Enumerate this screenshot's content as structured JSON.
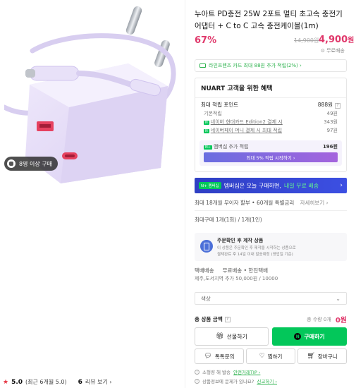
{
  "product": {
    "title": "누아트 PD충전 25W 2포트 멀티 초고속 충전기 어댑터 + C to C 고속 충전케이블(1m)",
    "discount": "67%",
    "original_price": "14,900원",
    "price": "4,900",
    "price_unit": "원",
    "shipping": "⊙ 무료배송",
    "buyers_badge": "8명 이상 구매",
    "rating": "5.0",
    "rating_note": "(최근 6개월 5.0)",
    "review_count": "6",
    "review_label": "리뷰 보기 ›"
  },
  "card_banner": {
    "text": "라인프렌즈 카드 최대 88원 추가 적립(2%) ›"
  },
  "benefit": {
    "header": "NUART 고객을 위한 혜택",
    "max_label": "최대 적립 포인트",
    "max_value": "888원",
    "rows": [
      {
        "label": "기본적립",
        "value": "49원"
      },
      {
        "label": "네이버 현대카드 Edition2 결제 시",
        "value": "343원"
      },
      {
        "label": "네이버페이 머니 결제 시 최대 적립",
        "value": "97원"
      }
    ],
    "member_label": "멤버십 추가 적립",
    "member_value": "196원",
    "member_bar": "최대 5% 적립 시작하기 ›",
    "badge": "N+"
  },
  "membership_banner": {
    "badge": "N+ 멤버십",
    "text": "멤버십은 오늘 구매하면,",
    "highlight": "내일 무료 배송"
  },
  "installment": {
    "text": "최대 18개월 무이자 할부 • 60개월 특별금리",
    "more": "자세히보기 ›"
  },
  "max_purchase": "최대구매 1개(1회) / 1개(1인)",
  "order_box": {
    "title": "주문확인 후 제작 상품",
    "line1": "이 상품은 주문확인 후 제작을 시작하는 상품으로",
    "line2": "결제완료 후 14일 이내 발송예정 (영업일 기준)"
  },
  "delivery": {
    "label": "택배배송",
    "value": "무료배송 • 한진택배",
    "jeju": "제주,도서지역 추가 50,000원 / 10000"
  },
  "option": {
    "placeholder": "색상"
  },
  "total": {
    "label": "총 상품 금액",
    "qty": "총 수량 0개",
    "amount": "0원"
  },
  "buttons": {
    "gift": "선물하기",
    "buy": "구매하기",
    "talk": "톡톡문의",
    "zzim": "찜하기",
    "cart": "장바구니"
  },
  "notices": [
    {
      "text": "소형량 해 발송",
      "link": "안전거래TIP ›"
    },
    {
      "text": "상품정보에 문제가 있나요?",
      "link": "신고하기 ›"
    }
  ],
  "colors": {
    "accent_pink": "#e0386b",
    "naver_green": "#03c75a",
    "membership_blue": "#3c4fe2"
  }
}
